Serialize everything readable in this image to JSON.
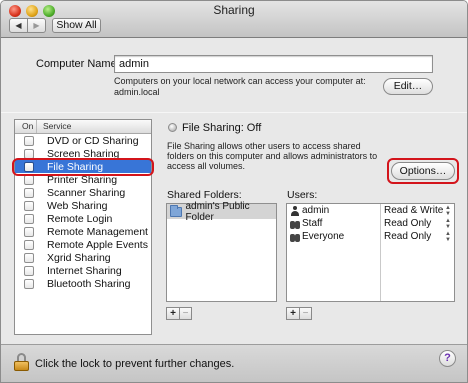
{
  "window": {
    "title": "Sharing"
  },
  "toolbar": {
    "back_glyph": "◀",
    "forward_glyph": "▶",
    "show_all_label": "Show All"
  },
  "computer_name": {
    "label": "Computer Name:",
    "value": "admin",
    "note_line1": "Computers on your local network can access your computer at:",
    "note_line2": "admin.local",
    "edit_label": "Edit…"
  },
  "services": {
    "header_on": "On",
    "header_service": "Service",
    "items": [
      {
        "label": "DVD or CD Sharing",
        "selected": false
      },
      {
        "label": "Screen Sharing",
        "selected": false
      },
      {
        "label": "File Sharing",
        "selected": true
      },
      {
        "label": "Printer Sharing",
        "selected": false
      },
      {
        "label": "Scanner Sharing",
        "selected": false
      },
      {
        "label": "Web Sharing",
        "selected": false
      },
      {
        "label": "Remote Login",
        "selected": false
      },
      {
        "label": "Remote Management",
        "selected": false
      },
      {
        "label": "Remote Apple Events",
        "selected": false
      },
      {
        "label": "Xgrid Sharing",
        "selected": false
      },
      {
        "label": "Internet Sharing",
        "selected": false
      },
      {
        "label": "Bluetooth Sharing",
        "selected": false
      }
    ]
  },
  "detail": {
    "status": "File Sharing: Off",
    "description": "File Sharing allows other users to access shared folders on this computer and allows administrators to access all volumes.",
    "options_label": "Options…",
    "shared_folders_label": "Shared Folders:",
    "users_label": "Users:",
    "shared_folders": [
      "admin's Public Folder"
    ],
    "users": [
      {
        "name": "admin",
        "permission": "Read & Write",
        "icon": "single-user-icon"
      },
      {
        "name": "Staff",
        "permission": "Read Only",
        "icon": "group-icon"
      },
      {
        "name": "Everyone",
        "permission": "Read Only",
        "icon": "group-icon"
      }
    ],
    "add_glyph": "+",
    "remove_glyph": "−"
  },
  "footer": {
    "lock_text": "Click the lock to prevent further changes.",
    "help_glyph": "?"
  },
  "highlights": {
    "color": "#d3141b"
  }
}
